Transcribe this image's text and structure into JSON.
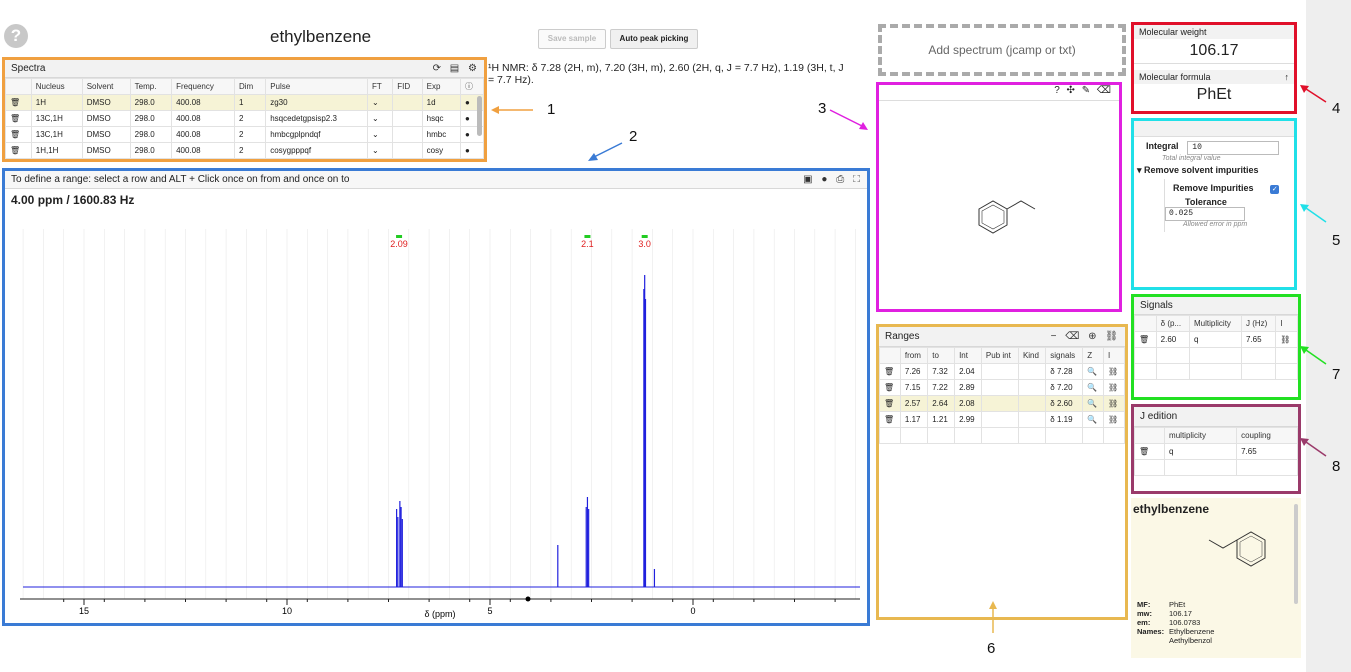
{
  "header": {
    "help_icon": "?",
    "title": "ethylbenzene",
    "save_label": "Save sample",
    "auto_label": "Auto peak picking",
    "nmr_text_1": "¹H NMR: δ 7.28 (2H, m), 7.20 (3H, m), 2.60 (2H, q, J = 7.7 Hz), 1.19 (3H, t, J",
    "nmr_text_2": "= 7.7 Hz)."
  },
  "spectra": {
    "title": "Spectra",
    "headers": [
      "",
      "Nucleus",
      "Solvent",
      "Temp.",
      "Frequency",
      "Dim",
      "Pulse",
      "FT",
      "FID",
      "Exp",
      "ⓘ"
    ],
    "rows": [
      {
        "nucleus": "1H",
        "solvent": "DMSO",
        "temp": "298.0",
        "freq": "400.08",
        "dim": "1",
        "pulse": "zg30",
        "exp": "1d"
      },
      {
        "nucleus": "13C,1H",
        "solvent": "DMSO",
        "temp": "298.0",
        "freq": "400.08",
        "dim": "2",
        "pulse": "hsqcedetgpsisp2.3",
        "exp": "hsqc"
      },
      {
        "nucleus": "13C,1H",
        "solvent": "DMSO",
        "temp": "298.0",
        "freq": "400.08",
        "dim": "2",
        "pulse": "hmbcgplpndqf",
        "exp": "hmbc"
      },
      {
        "nucleus": "1H,1H",
        "solvent": "DMSO",
        "temp": "298.0",
        "freq": "400.08",
        "dim": "2",
        "pulse": "cosygpppqf",
        "exp": "cosy"
      }
    ]
  },
  "spectrum": {
    "hint": "To define a range: select a row and ALT + Click once on from and once on to",
    "cursor": "4.00 ppm / 1600.83 Hz",
    "xlabel": "δ (ppm)",
    "ticks": [
      "15",
      "10",
      "5",
      "0"
    ],
    "integrals": [
      "2.09",
      "2.1",
      "3.0"
    ]
  },
  "add_spectrum": "Add spectrum (jcamp or txt)",
  "molecule_panel": {
    "icons": "? ✣ ✎ ⌫"
  },
  "molecular_weight": {
    "label": "Molecular weight",
    "value": "106.17"
  },
  "molecular_formula": {
    "label": "Molecular formula",
    "value": "PhEt"
  },
  "integral_panel": {
    "integral_label": "Integral",
    "integral_value": "10",
    "integral_help": "Total integral value",
    "remove_section": "▾ Remove solvent impurities",
    "remove_label": "Remove Impurities",
    "tolerance_label": "Tolerance",
    "tolerance_value": "0.025",
    "tolerance_help": "Allowed error in ppm"
  },
  "ranges": {
    "title": "Ranges",
    "headers": [
      "",
      "from",
      "to",
      "Int",
      "Pub int",
      "Kind",
      "signals",
      "Z",
      "I"
    ],
    "rows": [
      {
        "from": "7.26",
        "to": "7.32",
        "int": "2.04",
        "signal": "δ 7.28"
      },
      {
        "from": "7.15",
        "to": "7.22",
        "int": "2.89",
        "signal": "δ 7.20"
      },
      {
        "from": "2.57",
        "to": "2.64",
        "int": "2.08",
        "signal": "δ 2.60"
      },
      {
        "from": "1.17",
        "to": "1.21",
        "int": "2.99",
        "signal": "δ 1.19"
      }
    ]
  },
  "signals": {
    "title": "Signals",
    "headers": [
      "",
      "δ (p...",
      "Multiplicity",
      "J (Hz)",
      "I"
    ],
    "row": {
      "delta": "2.60",
      "mult": "q",
      "j": "7.65"
    }
  },
  "j_edition": {
    "title": "J edition",
    "headers": [
      "",
      "multiplicity",
      "coupling"
    ],
    "row": {
      "mult": "q",
      "coupling": "7.65"
    }
  },
  "info_card": {
    "title": "ethylbenzene",
    "mf_label": "MF:",
    "mf": "PhEt",
    "mw_label": "mw:",
    "mw": "106.17",
    "em_label": "em:",
    "em": "106.0783",
    "names_label": "Names:",
    "name1": "Ethylbenzene",
    "name2": "Aethylbenzol"
  },
  "callouts": [
    "1",
    "2",
    "3",
    "4",
    "5",
    "6",
    "7",
    "8"
  ],
  "colors": {
    "orange": "#f0a040",
    "blue": "#3a7bd5",
    "magenta": "#e020e0",
    "red": "#e0102a",
    "cyan": "#20e0e8",
    "green": "#22e022",
    "plum": "#9a3a6a",
    "gold": "#e8b850",
    "spectrum": "#2020dd"
  }
}
